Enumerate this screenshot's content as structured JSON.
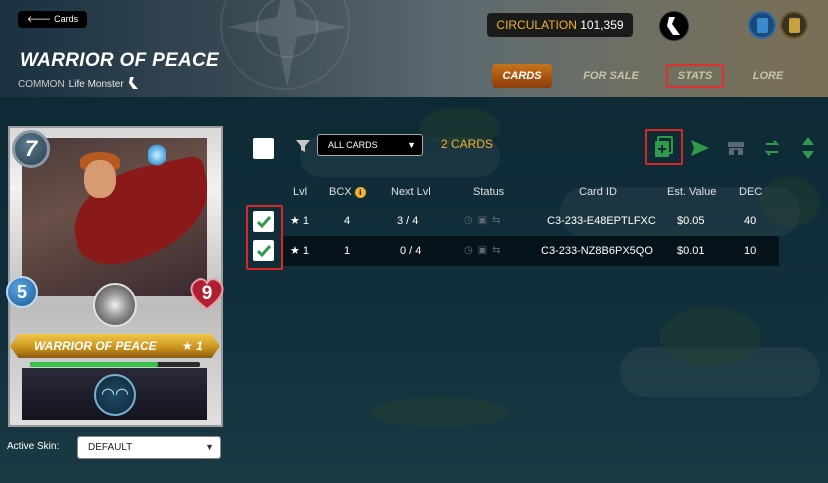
{
  "header": {
    "back_label": "Cards",
    "title": "WARRIOR OF PEACE",
    "subtitle_rarity": "COMMON",
    "subtitle_type": "Life Monster",
    "circulation_label": "CIRCULATION",
    "circulation_value": "101,359"
  },
  "tabs": [
    {
      "label": "CARDS",
      "active": true
    },
    {
      "label": "FOR SALE",
      "active": false
    },
    {
      "label": "STATS",
      "active": false
    },
    {
      "label": "LORE",
      "active": false
    }
  ],
  "card": {
    "mana": "7",
    "speed": "5",
    "health": "9",
    "name": "WARRIOR OF PEACE",
    "level": "★ 1",
    "xp_fraction": 0.75,
    "ability_icon": "ability-icon",
    "ability_glyph": "◠◠",
    "colors": {
      "name_banner": "#e0a830",
      "life_health": "#c8283a",
      "speed": "#3a8ad0"
    }
  },
  "skin": {
    "label": "Active Skin:",
    "value": "DEFAULT"
  },
  "toolbar": {
    "filter_value": "ALL CARDS",
    "cards_count": "2 CARDS",
    "icons": [
      "combine-icon",
      "send-icon",
      "market-icon",
      "transfer-icon",
      "sort-icon"
    ]
  },
  "table": {
    "headers": [
      "Lvl",
      "BCX",
      "Next Lvl",
      "Status",
      "Card ID",
      "Est. Value",
      "DEC"
    ],
    "rows": [
      {
        "lvl": "★ 1",
        "bcx": "4",
        "next": "3 / 4",
        "id": "C3-233-E48EPTLFXC",
        "value": "$0.05",
        "dec": "40",
        "checked": true
      },
      {
        "lvl": "★ 1",
        "bcx": "1",
        "next": "0 / 4",
        "id": "C3-233-NZ8B6PX5QO",
        "value": "$0.01",
        "dec": "10",
        "checked": true
      }
    ]
  },
  "colors": {
    "accent_orange": "#f0b030",
    "active_tab": "#c8731c",
    "checkbox_green": "#2e9a4a",
    "highlight_red": "#d82828",
    "action_green": "#2e9a4a"
  }
}
